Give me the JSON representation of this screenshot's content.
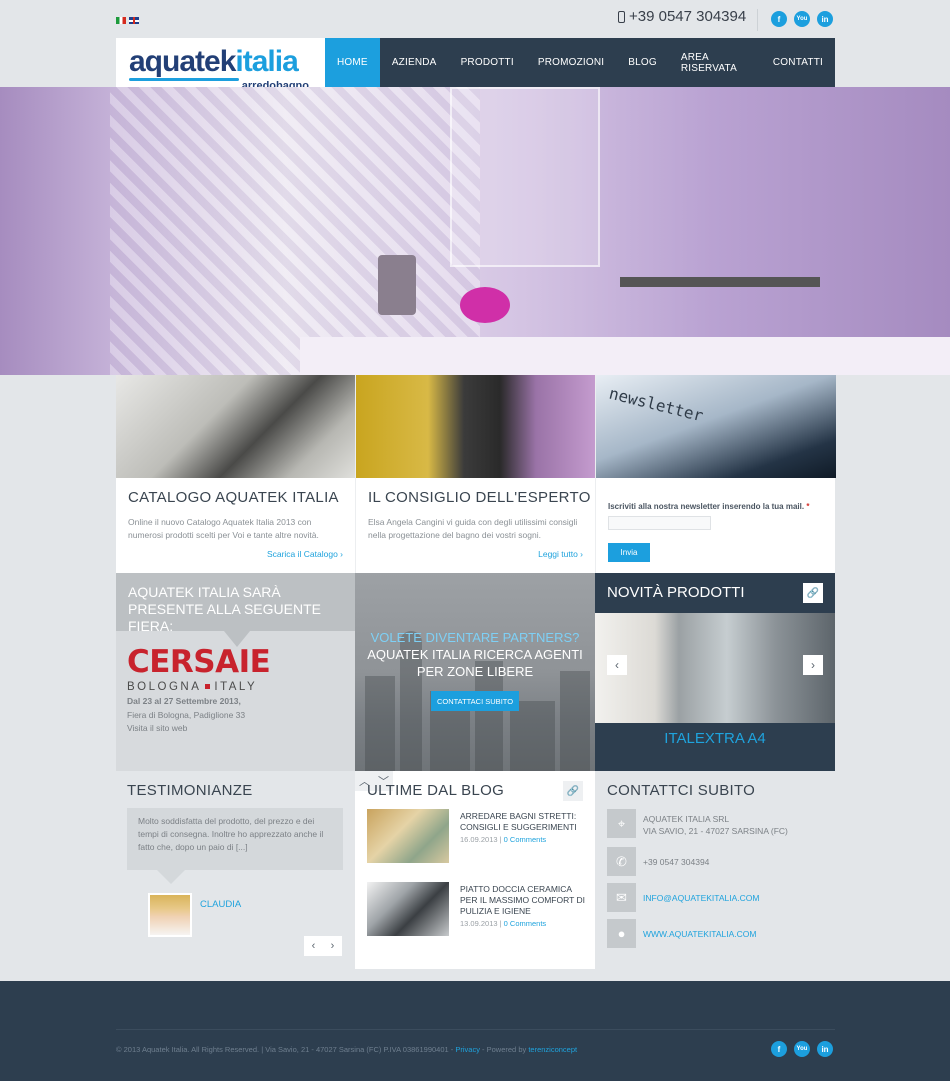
{
  "topbar": {
    "phone": "+39 0547 304394",
    "social": [
      {
        "name": "facebook",
        "glyph": "f"
      },
      {
        "name": "youtube",
        "glyph": "You"
      },
      {
        "name": "linkedin",
        "glyph": "in"
      }
    ]
  },
  "logo": {
    "part1": "aquatek",
    "part2": "italia",
    "sub": "arredobagno"
  },
  "nav": {
    "items": [
      "HOME",
      "AZIENDA",
      "PRODOTTI",
      "PROMOZIONI",
      "BLOG",
      "AREA RISERVATA",
      "CONTATTI"
    ],
    "active": "HOME"
  },
  "catalog": {
    "title": "CATALOGO AQUATEK ITALIA",
    "text": "Online il nuovo Catalogo Aquatek Italia 2013 con numerosi prodotti scelti per Voi e tante altre novità.",
    "link": "Scarica il Catalogo ›"
  },
  "expert": {
    "title": "IL CONSIGLIO DELL'ESPERTO",
    "text": "Elsa Angela Cangini vi guida con degli utilissimi consigli nella progettazione del bagno dei vostri sogni.",
    "link": "Leggi tutto ›"
  },
  "newsletter": {
    "image_word": "newsletter",
    "label": "Iscriviti alla nostra newsletter inserendo la tua mail.",
    "required_mark": "*",
    "input_value": "",
    "button": "Invia"
  },
  "fair": {
    "title": "AQUATEK ITALIA SARÀ PRESENTE ALLA SEGUENTE FIERA:",
    "logo_main": "CERSAIE",
    "logo_sub_left": "BOLOGNA",
    "logo_sub_right": "ITALY",
    "date": "Dal 23 al 27 Settembre 2013,",
    "place": "Fiera di Bologna, Padiglione 33",
    "site": "Visita il sito web"
  },
  "partners": {
    "question": "VOLETE DIVENTARE PARTNERS?",
    "line1": "AQUATEK ITALIA RICERCA AGENTI",
    "line2": "PER ZONE LIBERE",
    "button": "CONTATTACI SUBITO"
  },
  "new_products": {
    "title": "NOVITÀ PRODOTTI",
    "product_name": "ITALEXTRA A4"
  },
  "testimonials": {
    "title": "TESTIMONIANZE",
    "quote": "Molto soddisfatta del prodotto, del prezzo e dei tempi di consegna. Inoltre ho apprezzato anche il fatto che, dopo un paio di [...]",
    "author": "CLAUDIA"
  },
  "blog": {
    "title": "ULTIME DAL BLOG",
    "posts": [
      {
        "title": "ARREDARE BAGNI STRETTI: CONSIGLI E SUGGERIMENTI",
        "date": "16.09.2013",
        "comments": "0 Comments"
      },
      {
        "title": "PIATTO DOCCIA CERAMICA PER IL MASSIMO COMFORT DI PULIZIA E IGIENE",
        "date": "13.09.2013",
        "comments": "0 Comments"
      }
    ]
  },
  "contacts": {
    "title": "CONTATTCI SUBITO",
    "company": "AQUATEK ITALIA SRL",
    "address": "VIA SAVIO, 21 - 47027 SARSINA (FC)",
    "phone": "+39 0547 304394",
    "email": "INFO@AQUATEKITALIA.COM",
    "website": "WWW.AQUATEKITALIA.COM"
  },
  "footer": {
    "copyright": "© 2013 Aquatek Italia. All Rights Reserved. | Via Savio, 21 - 47027 Sarsina (FC) P.IVA 03861990401 -",
    "privacy": "Privacy",
    "powered": "- Powered by",
    "agency": "terenziconcept"
  },
  "colors": {
    "accent": "#1c9fde",
    "navy": "#2d3e4f",
    "brand_red": "#c8232d"
  }
}
